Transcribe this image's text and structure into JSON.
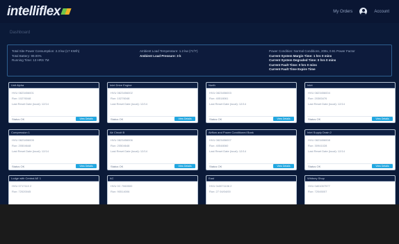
{
  "app": {
    "logo_text": "intelliflex",
    "logo_accent": "#6fc44a",
    "logo_accent2": "#f0b126"
  },
  "topnav": {
    "link": "My Orders",
    "user_icon": "user-circle-icon",
    "user_label": "Account"
  },
  "breadcrumb": "Dashboard",
  "summary": {
    "col1": [
      "Total Site Power Consumption: 2.3 kw (17 KW/h)",
      "Total Battery: 99.00%",
      "Running Time: 13 HRS 7M"
    ],
    "col2": [
      "Ambient Load Temperature: 1.2 kw (71°F)",
      "Ambient Load Pressure: 3 k"
    ],
    "col3": [
      "Power Condition: Normal Conditions, 208v, 0.91 Power Factor",
      "Current System Margin Time: 1 hrs 0 mins",
      "Current System Degraded Time: 0 hrs 0 mins",
      "Current Fault Time: 0 hrs 0 mins",
      "Current Fault Time Expire Time"
    ]
  },
  "cards": [
    {
      "title": "Unit Alpha",
      "lines": [
        "HVU 0823456001",
        "Run: 10276048",
        "Last Reset Date (local): 12/14"
      ],
      "status": "Status OK",
      "button": "View Details"
    },
    {
      "title": "Inlet Drive Engine",
      "lines": [
        "HVU 0823456002",
        "Run: 10276048",
        "Last Reset Date (local): 12/14"
      ],
      "status": "Status OK",
      "button": "View Details"
    },
    {
      "title": "North",
      "lines": [
        "HVU 0823456003",
        "Run: 40518061",
        "Last Reset Date (local): 12/14"
      ],
      "status": "Status OK",
      "button": "View Details"
    },
    {
      "title": "Inlet",
      "lines": [
        "HVU 0823456004",
        "Run: 20383476",
        "Last Reset Date (local): 12/14"
      ],
      "status": "Status OK",
      "button": "View Details"
    },
    {
      "title": "Compression 1",
      "lines": [
        "HVU 0823456005",
        "Run: 20504648",
        "Last Reset Date (local): 12/14"
      ],
      "status": "Status OK",
      "button": "View Details"
    },
    {
      "title": "Air Circuit B",
      "lines": [
        "HVU 0823456006",
        "Run: 20504648",
        "Last Reset Date (local): 12/14"
      ],
      "status": "Status OK",
      "button": "View Details"
    },
    {
      "title": "Airflow and Power Conditioned Bank",
      "lines": [
        "HVU 0823456007",
        "Run: 40548060",
        "Last Reset Date (local): 12/14"
      ],
      "status": "Status OK",
      "button": "View Details"
    },
    {
      "title": "Inlet Supply Drain 2",
      "lines": [
        "HVU 0823456008",
        "Run: 30941028",
        "Last Reset Date (local): 12/14"
      ],
      "status": "Status OK",
      "button": "View Details"
    },
    {
      "title": "Lodge with Central AE 1",
      "lines": [
        "HVU 0717110 2",
        "Run: 72020045"
      ],
      "status": "",
      "button": ""
    },
    {
      "title": "AC",
      "lines": [
        "HVU 0C 7060500",
        "Run: 90514006"
      ],
      "status": "",
      "button": ""
    },
    {
      "title": "East",
      "lines": [
        "HVU 0x0071106 2",
        "Run: 27 04/04/00"
      ],
      "status": "",
      "button": ""
    },
    {
      "title": "Whitney Shop",
      "lines": [
        "HVU 0d01007577",
        "Run: 72045007"
      ],
      "status": "",
      "button": ""
    }
  ]
}
